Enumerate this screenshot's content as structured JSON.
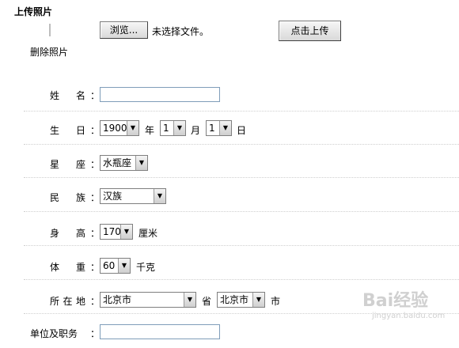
{
  "upload": {
    "title": "上传照片",
    "browse_label": "浏览...",
    "no_file_text": "未选择文件。",
    "upload_label": "点击上传",
    "delete_label": "删除照片"
  },
  "form": {
    "name": {
      "label": "姓 名",
      "colon": "：",
      "value": ""
    },
    "birthday": {
      "label": "生 日",
      "colon": "：",
      "year": "1900",
      "year_unit": "年",
      "month": "1",
      "month_unit": "月",
      "day": "1",
      "day_unit": "日"
    },
    "zodiac": {
      "label": "星 座",
      "colon": "：",
      "value": "水瓶座"
    },
    "ethnicity": {
      "label": "民 族",
      "colon": "：",
      "value": "汉族"
    },
    "height": {
      "label": "身 高",
      "colon": "：",
      "value": "170",
      "unit": "厘米"
    },
    "weight": {
      "label": "体 重",
      "colon": "：",
      "value": "60",
      "unit": "千克"
    },
    "location": {
      "label": "所 在 地",
      "colon": "：",
      "province": "北京市",
      "province_unit": "省",
      "city": "北京市",
      "city_unit": "市"
    },
    "employer": {
      "label": "单位及职务",
      "colon": "：",
      "value": ""
    }
  },
  "watermark": {
    "main": "Bai经验",
    "sub": "jingyan.baidu.com"
  }
}
